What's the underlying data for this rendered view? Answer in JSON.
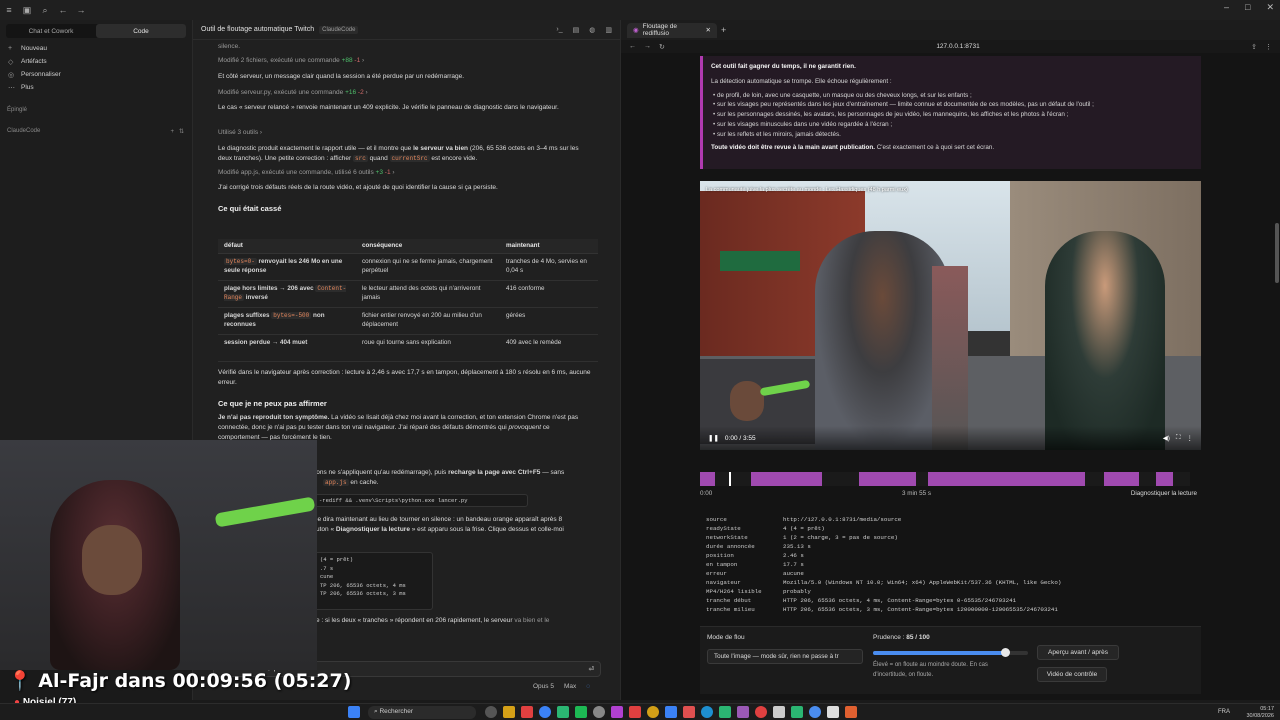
{
  "sidebar": {
    "tabs": [
      "Chat et Cowork",
      "Code"
    ],
    "items": [
      {
        "icon": "plus-icon",
        "label": "Nouveau"
      },
      {
        "icon": "artifacts-icon",
        "label": "Artéfacts"
      },
      {
        "icon": "customize-icon",
        "label": "Personnaliser"
      },
      {
        "icon": "more-icon",
        "label": "Plus"
      }
    ],
    "section_pinned": "Épinglé",
    "section_project": "ClaudeCode"
  },
  "chat": {
    "title": "Outil de floutage automatique Twitch",
    "tag": "ClaudeCode",
    "lines": {
      "l0": "silence.",
      "l1_text": "Modifié 2 fichiers, exécuté une commande",
      "l1_plus": "+88",
      "l1_minus": "-1",
      "l2": "Et côté serveur, un message clair quand la session a été perdue par un redémarrage.",
      "l3_text": "Modifié serveur.py, exécuté une commande",
      "l3_plus": "+16",
      "l3_minus": "-2",
      "l4": "Le cas « serveur relancé » renvoie maintenant un 409 explicite. Je vérifie le panneau de diagnostic dans le navigateur.",
      "l5": "Utilisé 3 outils",
      "l6a": "Le diagnostic produit exactement le rapport utile — et il montre que ",
      "l6b": "le serveur va bien",
      "l6c": " (206, 65 536 octets en 3–4 ms sur les deux tranches). Une petite correction : afficher ",
      "l6code1": "src",
      "l6d": " quand ",
      "l6code2": "currentSrc",
      "l6e": " est encore vide.",
      "l7_text": "Modifié app.js, exécuté une commande, utilisé 6 outils",
      "l7_plus": "+3",
      "l7_minus": "-1",
      "l8": "J'ai corrigé trois défauts réels de la route vidéo, et ajouté de quoi identifier la cause si ça persiste.",
      "h1": "Ce qui était cassé",
      "verif": "Vérifié dans le navigateur après correction : lecture à 2,46 s avec 17,7 s en tampon, déplacement à 180 s résolu en 6 ms, aucune erreur.",
      "h2": "Ce que je ne peux pas affirmer",
      "p2a": "Je n'ai pas reproduit ton symptôme.",
      "p2b": " La vidéo se lisait déjà chez moi avant la correction, et ton extension Chrome n'est pas connectée, donc je n'ai pas pu tester dans ton vrai navigateur. J'ai réparé des défauts démontrés qui ",
      "p2c": "provoquent",
      "p2d": " ce comportement — pas forcément le tien.",
      "h3": "À faire de ton côté",
      "p3a": "tions ne s'appliquent qu'au redémarrage), puis ",
      "p3b": "recharge la page avec Ctrl+F5",
      "p3c": " — sans",
      "p3d_code": "app.js",
      "p3e": " en cache.",
      "cmd": "-rediff && .venv\\Scripts\\python.exe lancer.py",
      "p4": "le dira maintenant au lieu de tourner en silence : un bandeau orange apparaît après 8",
      "p5a": "uton « ",
      "p5b": "Diagnostiquer la lecture",
      "p5c": " » est apparu sous la frise. Clique dessus et colle-moi",
      "term": [
        "(4 = prêt)",
        ".7 s",
        "cune",
        "TP 206, 65536 octets, 4 ms",
        "TP 206, 65536 octets, 3 ms"
      ],
      "p6a": "e : si les deux « tranches » répondent en 206 rapidement, le serveur ",
      "p6b": "va bien et le"
    },
    "table": {
      "headers": [
        "défaut",
        "conséquence",
        "maintenant"
      ],
      "rows": [
        {
          "c1_code": "bytes=0-",
          "c1": " renvoyait les 246 Mo en une seule réponse",
          "c2": "connexion qui ne se ferme jamais, chargement perpétuel",
          "c3": "tranches de 4 Mo, servies en 0,04 s"
        },
        {
          "c1_pre": "plage hors limites → 206 avec ",
          "c1_code": "Content-Range",
          "c1": " inversé",
          "c2": "le lecteur attend des octets qui n'arriveront jamais",
          "c3": "416 conforme"
        },
        {
          "c1_pre": "plages suffixes ",
          "c1_code": "bytes=-500",
          "c1": " non reconnues",
          "c2": "fichier entier renvoyé en 200 au milieu d'un déplacement",
          "c3": "gérées"
        },
        {
          "c1_pre": "session perdue → 404 muet",
          "c1_code": "",
          "c1": "",
          "c2": "roue qui tourne sans explication",
          "c3": "409 avec le remède"
        }
      ]
    },
    "input_value": "Enfaite le lecteur, qu",
    "model": "Opus 5",
    "effort": "Max"
  },
  "overlay": {
    "title": "Al-Fajr dans 00:09:56 (05:27)",
    "subtitle": "Noisiel (77)"
  },
  "browser": {
    "tab_label": "Floutage de rediffusio",
    "url": "127.0.0.1:8731",
    "warning": {
      "title": "Cet outil fait gagner du temps, il ne garantit rien.",
      "intro": "La détection automatique se trompe. Elle échoue régulièrement :",
      "bullets": [
        "de profil, de loin, avec une casquette, un masque ou des cheveux longs, et sur les enfants ;",
        "sur les visages peu représentés dans les jeux d'entraînement — limite connue et documentée de ces modèles, pas un défaut de l'outil ;",
        "sur les personnages dessinés, les avatars, les personnages de jeu vidéo, les mannequins, les affiches et les photos à l'écran ;",
        "sur les visages minuscules dans une vidéo regardée à l'écran ;",
        "sur les reflets et les miroirs, jamais détectés."
      ],
      "final_bold": "Toute vidéo doit être revue à la main avant publication.",
      "final_rest": " C'est exactement ce à quoi sert cet écran."
    },
    "video": {
      "caption": "La communauté juive la plus secrète au monde : Les Hassidiques (48 h parmi eux)",
      "time": "0:00 / 3:55",
      "progress": 0.02
    },
    "timeline": {
      "start": "0:00",
      "mid": "3 min 55 s",
      "segments": [
        [
          0.0,
          0.03
        ],
        [
          0.105,
          0.25
        ],
        [
          0.325,
          0.44
        ],
        [
          0.465,
          0.785
        ],
        [
          0.825,
          0.895
        ],
        [
          0.93,
          0.965
        ]
      ],
      "cursor": 0.06,
      "diagnose_label": "Diagnostiquer la lecture"
    },
    "diagnostics": [
      [
        "source",
        "http://127.0.0.1:8731/media/source"
      ],
      [
        "readyState",
        "4 (4 = prêt)"
      ],
      [
        "networkState",
        "1 (2 = charge, 3 = pas de source)"
      ],
      [
        "durée annoncée",
        "235.13 s"
      ],
      [
        "position",
        "2.46 s"
      ],
      [
        "en tampon",
        "17.7 s"
      ],
      [
        "erreur",
        "aucune"
      ],
      [
        "navigateur",
        "Mozilla/5.0 (Windows NT 10.0; Win64; x64) AppleWebKit/537.36 (KHTML, like Gecko)"
      ],
      [
        "MP4/H264 lisible",
        "probably"
      ],
      [
        "tranche début",
        "HTTP 206, 65536 octets, 4 ms, Content-Range=bytes 0-65535/246703241"
      ],
      [
        "tranche milieu",
        "HTTP 206, 65536 octets, 3 ms, Content-Range=bytes 120000000-120065535/246703241"
      ]
    ],
    "settings": {
      "mode_label": "Mode de flou",
      "mode_value": "Toute l'image — mode sûr, rien ne passe à tr",
      "prudence_label": "Prudence : ",
      "prudence_value": "85 / 100",
      "prudence_fraction": 0.85,
      "prudence_help": "Élevé = on floute au moindre doute. En cas d'incertitude, on floute.",
      "btn_compare": "Aperçu avant / après",
      "btn_control": "Vidéo de contrôle"
    }
  },
  "taskbar": {
    "search": "Rechercher",
    "lang": "FRA",
    "time": "05:17",
    "date": "30/08/2026"
  }
}
